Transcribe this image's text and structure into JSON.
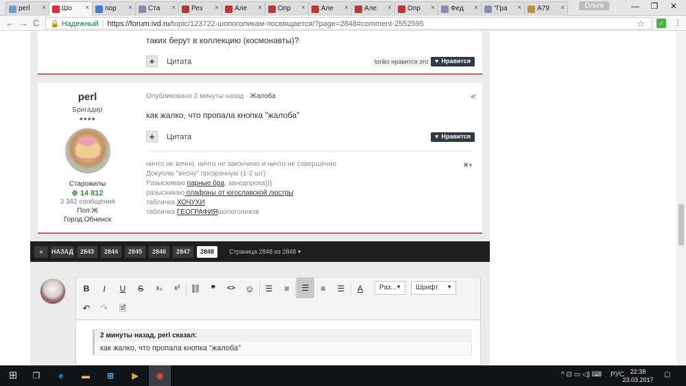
{
  "browser": {
    "tabs": [
      {
        "label": "perl",
        "color": "#6aa0c8"
      },
      {
        "label": "Шо",
        "color": "#cc3333"
      },
      {
        "label": "пор",
        "color": "#3a7fd5"
      },
      {
        "label": "Ста",
        "color": "#8c8cb0"
      },
      {
        "label": "Рез",
        "color": "#b23a3a"
      },
      {
        "label": "Але",
        "color": "#b23a3a"
      },
      {
        "label": "Опр",
        "color": "#b23a3a"
      },
      {
        "label": "Але",
        "color": "#b23a3a"
      },
      {
        "label": "Але",
        "color": "#b23a3a"
      },
      {
        "label": "Опр",
        "color": "#b23a3a"
      },
      {
        "label": "Фед",
        "color": "#8c8cb0"
      },
      {
        "label": "\"Гра",
        "color": "#8c8cb0"
      },
      {
        "label": "А79",
        "color": "#c09040"
      }
    ],
    "user_badge": "Ольга",
    "win_min": "—",
    "win_max": "❐",
    "win_close": "✕",
    "nav_back": "←",
    "nav_forward": "→",
    "nav_reload": "C",
    "lock_icon": "🔒",
    "secure_label": "Надежный",
    "url_host": "https://forum.ivd.ru",
    "url_path": "/topic/123722-шопоголикам-посвящается/?page=2848#comment-2552595",
    "star_icon": "☆",
    "ext_label": "✓",
    "menu_icon": "⋮"
  },
  "prev_post": {
    "text": "таких берут в коллекцию (космонавты)?",
    "plus": "+",
    "quote_label": "Цитата",
    "likes_meta": "tonko нравится это",
    "like_label": "Нравится"
  },
  "post": {
    "author": {
      "name": "perl",
      "rank": "Бригадир",
      "pips": "●●●●",
      "group": "Старожилы",
      "reputation": "14 812",
      "posts": "3 342 сообщения",
      "gender": "Пол:Ж",
      "city": "Город:Обнинск"
    },
    "meta": "Опубликовано 2 минуты назад",
    "meta_sep": " · ",
    "report": "Жалоба",
    "share_icon": "⋞",
    "text": "как жалко, что пропала кнопка \"жалоба\"",
    "plus": "+",
    "quote_label": "Цитата",
    "like_label": "Нравится",
    "signature": [
      {
        "pre": "ничто не вечно, ничто не закончено и ничто не совершенно",
        "link": "",
        "post": ""
      },
      {
        "pre": "Докуплю \"весну\" прозрачную (1-2 шт)",
        "link": "",
        "post": ""
      },
      {
        "pre": "Разыскиваю ",
        "link": "парные бра",
        "post": ", занедороха)))"
      },
      {
        "pre": "разыскиваю",
        "link": " плафоны от югославской люстры",
        "post": ""
      },
      {
        "pre": "табличка ",
        "link": "ХОЧУХИ",
        "post": ""
      },
      {
        "pre": "табличка ",
        "link": "ГЕОГРАФИЯ",
        "post": "шопоголиков"
      }
    ],
    "sig_ctrl": "✖▾"
  },
  "pagination": {
    "first": "«",
    "prev": "НАЗАД",
    "pages": [
      "2843",
      "2844",
      "2845",
      "2846",
      "2847",
      "2848"
    ],
    "current": "2848",
    "info": "Страница 2848 из 2848 ▾"
  },
  "editor": {
    "toolbar": {
      "bold": "B",
      "italic": "I",
      "underline": "U",
      "strike": "S",
      "subscript": "x₂",
      "superscript": "x²",
      "link": "⛓",
      "quote": "❞",
      "code": "<>",
      "emoji": "☺",
      "bullets": "☰",
      "numbers": "≡",
      "align_left": "☰",
      "align_center": "≡",
      "align_right": "☰",
      "text_color": "A",
      "size": "Раз...",
      "font": "Шрифт",
      "undo": "↶",
      "redo": "↷",
      "source": "🗎"
    },
    "quote_header": "2 минуты назад, perl сказал:",
    "quote_text": "как жалко, что пропала кнопка \"жалоба\""
  },
  "taskbar": {
    "start": "⊞",
    "task_view": "❐",
    "apps": [
      {
        "name": "edge-icon",
        "glyph": "e"
      },
      {
        "name": "explorer-icon",
        "glyph": "▬"
      },
      {
        "name": "store-icon",
        "glyph": "⊞"
      },
      {
        "name": "media-icon",
        "glyph": "▶"
      },
      {
        "name": "chrome-icon",
        "glyph": "◉"
      }
    ],
    "tray": "^  ⊡  ▭  ◁)  ⌨",
    "lang": "РУС",
    "time": "22:38",
    "date": "23.03.2017",
    "notify": "▢"
  }
}
